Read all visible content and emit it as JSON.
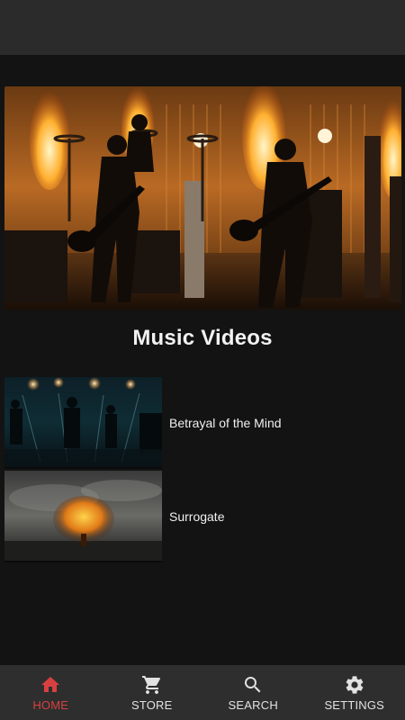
{
  "section": {
    "title": "Music Videos"
  },
  "videos": [
    {
      "title": "Betrayal of the Mind"
    },
    {
      "title": "Surrogate"
    }
  ],
  "nav": {
    "active": "home",
    "items": [
      {
        "id": "home",
        "label": "HOME",
        "icon": "home-icon"
      },
      {
        "id": "store",
        "label": "STORE",
        "icon": "cart-icon"
      },
      {
        "id": "search",
        "label": "SEARCH",
        "icon": "search-icon"
      },
      {
        "id": "settings",
        "label": "SETTINGS",
        "icon": "gear-icon"
      }
    ]
  },
  "colors": {
    "accent": "#d84040",
    "background": "#131313",
    "nav_background": "#2e2e2e",
    "top_bar": "#2b2b2b"
  }
}
